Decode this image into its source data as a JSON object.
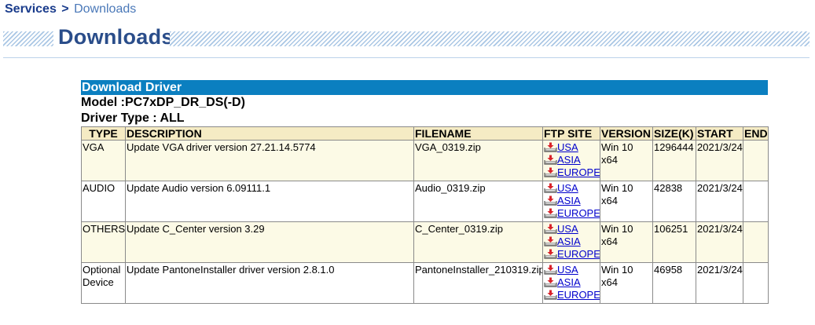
{
  "breadcrumb": {
    "root": "Services",
    "separator": ">",
    "current": "Downloads"
  },
  "page_title": "Downloads",
  "section": {
    "header": "Download Driver",
    "model": "Model :PC7xDP_DR_DS(-D)",
    "driver_type": "Driver Type : ALL"
  },
  "table": {
    "headers": {
      "type": "TYPE",
      "description": "DESCRIPTION",
      "filename": "FILENAME",
      "ftp_site": "FTP SITE",
      "version": "VERSION",
      "size": "SIZE(K)",
      "start": "START",
      "end": "END"
    },
    "rows": [
      {
        "type": "VGA",
        "description": "Update VGA driver version 27.21.14.5774",
        "filename": "VGA_0319.zip",
        "ftp": {
          "usa": "USA",
          "asia": "ASIA",
          "europe": "EUROPE"
        },
        "version": "Win 10 x64",
        "size": "1296444",
        "start": "2021/3/24",
        "end": ""
      },
      {
        "type": "AUDIO",
        "description": "Update Audio version 6.09111.1",
        "filename": "Audio_0319.zip",
        "ftp": {
          "usa": "USA",
          "asia": "ASIA",
          "europe": "EUROPE"
        },
        "version": "Win 10 x64",
        "size": "42838",
        "start": "2021/3/24",
        "end": ""
      },
      {
        "type": "OTHERS",
        "description": "Update C_Center version 3.29",
        "filename": "C_Center_0319.zip",
        "ftp": {
          "usa": "USA",
          "asia": "ASIA",
          "europe": "EUROPE"
        },
        "version": "Win 10 x64",
        "size": "106251",
        "start": "2021/3/24",
        "end": ""
      },
      {
        "type": "Optional Device",
        "description": "Update PantoneInstaller driver version 2.8.1.0",
        "filename": "PantoneInstaller_210319.zip",
        "ftp": {
          "usa": "USA",
          "asia": "ASIA",
          "europe": "EUROPE"
        },
        "version": "Win 10 x64",
        "size": "46958",
        "start": "2021/3/24",
        "end": ""
      }
    ]
  },
  "colors": {
    "header_bar": "#0b7fc0",
    "table_header_bg": "#f5ebc4",
    "row_alt_bg": "#fcfae6",
    "link": "#0000cc",
    "title": "#2a4d8a"
  },
  "icons": {
    "download": "download-icon"
  }
}
